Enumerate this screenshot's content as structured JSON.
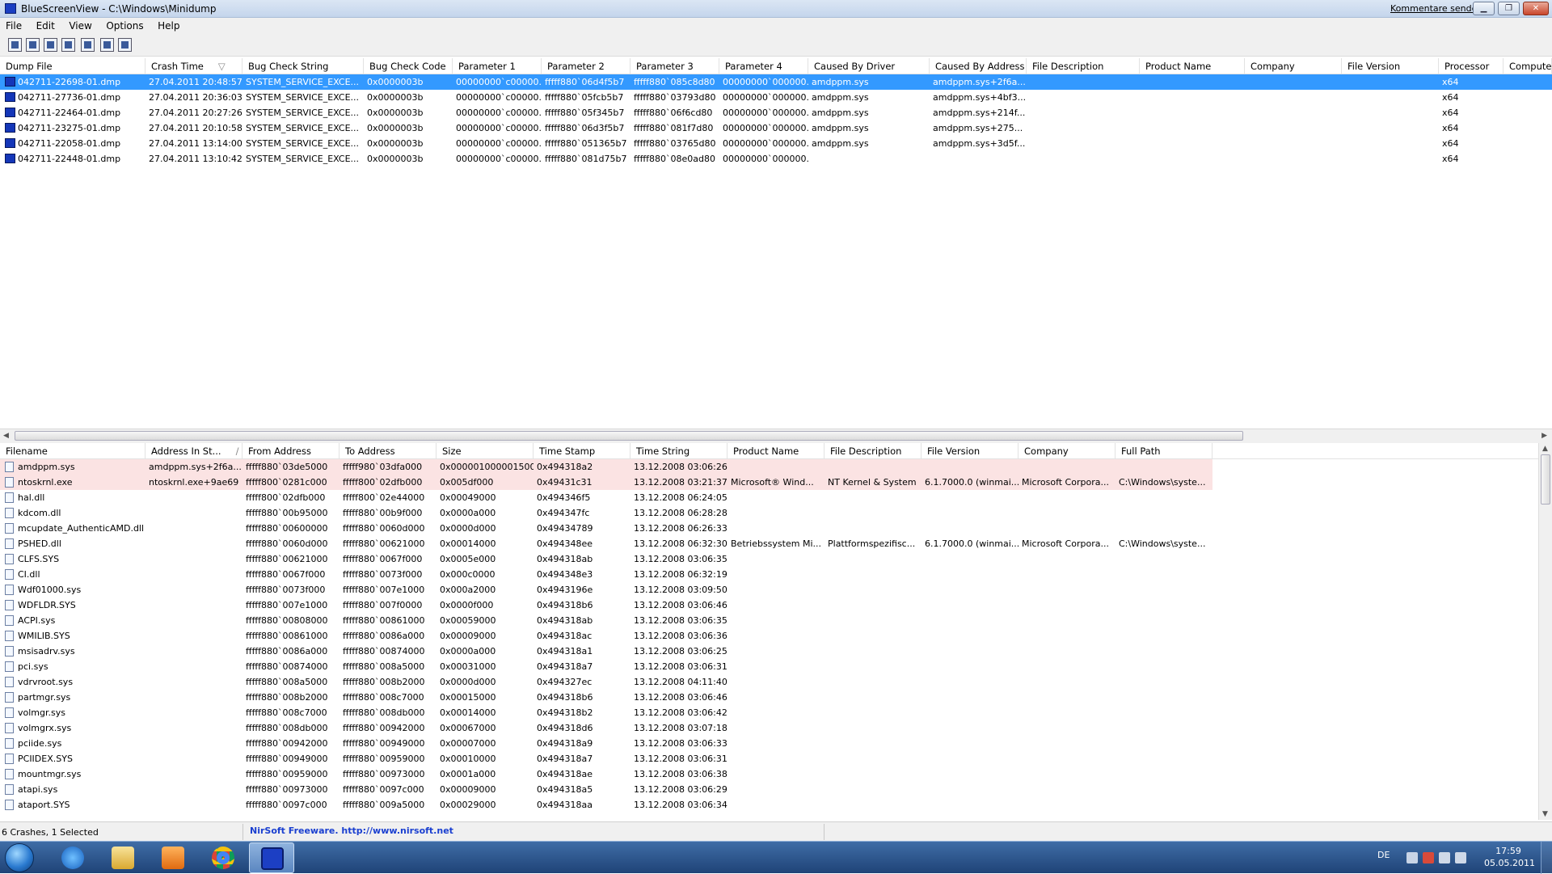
{
  "window": {
    "title": "BlueScreenView  -  C:\\Windows\\Minidump",
    "feedback_link": "Kommentare senden",
    "minimize": "▁",
    "maximize": "❐",
    "close": "✕"
  },
  "menu": [
    "File",
    "Edit",
    "View",
    "Options",
    "Help"
  ],
  "toolbar": {
    "icons": [
      "properties-icon",
      "save-icon",
      "refresh-icon",
      "copy-icon",
      "advanced-options-icon",
      "find-icon",
      "exit-icon"
    ]
  },
  "upper_columns": [
    "Dump File",
    "Crash Time",
    "Bug Check String",
    "Bug Check Code",
    "Parameter 1",
    "Parameter 2",
    "Parameter 3",
    "Parameter 4",
    "Caused By Driver",
    "Caused By Address",
    "File Description",
    "Product Name",
    "Company",
    "File Version",
    "Processor",
    "Computer"
  ],
  "upper_sort_indicator": "▽",
  "crashes": [
    [
      "042711-22698-01.dmp",
      "27.04.2011 20:48:57",
      "SYSTEM_SERVICE_EXCE...",
      "0x0000003b",
      "00000000`c00000...",
      "fffff880`06d4f5b7",
      "fffff880`085c8d80",
      "00000000`000000...",
      "amdppm.sys",
      "amdppm.sys+2f6a...",
      "",
      "",
      "",
      "",
      "x64",
      ""
    ],
    [
      "042711-27736-01.dmp",
      "27.04.2011 20:36:03",
      "SYSTEM_SERVICE_EXCE...",
      "0x0000003b",
      "00000000`c00000...",
      "fffff880`05fcb5b7",
      "fffff880`03793d80",
      "00000000`000000...",
      "amdppm.sys",
      "amdppm.sys+4bf3...",
      "",
      "",
      "",
      "",
      "x64",
      ""
    ],
    [
      "042711-22464-01.dmp",
      "27.04.2011 20:27:26",
      "SYSTEM_SERVICE_EXCE...",
      "0x0000003b",
      "00000000`c00000...",
      "fffff880`05f345b7",
      "fffff880`06f6cd80",
      "00000000`000000...",
      "amdppm.sys",
      "amdppm.sys+214f...",
      "",
      "",
      "",
      "",
      "x64",
      ""
    ],
    [
      "042711-23275-01.dmp",
      "27.04.2011 20:10:58",
      "SYSTEM_SERVICE_EXCE...",
      "0x0000003b",
      "00000000`c00000...",
      "fffff880`06d3f5b7",
      "fffff880`081f7d80",
      "00000000`000000...",
      "amdppm.sys",
      "amdppm.sys+275...",
      "",
      "",
      "",
      "",
      "x64",
      ""
    ],
    [
      "042711-22058-01.dmp",
      "27.04.2011 13:14:00",
      "SYSTEM_SERVICE_EXCE...",
      "0x0000003b",
      "00000000`c00000...",
      "fffff880`051365b7",
      "fffff880`03765d80",
      "00000000`000000...",
      "amdppm.sys",
      "amdppm.sys+3d5f...",
      "",
      "",
      "",
      "",
      "x64",
      ""
    ],
    [
      "042711-22448-01.dmp",
      "27.04.2011 13:10:42",
      "SYSTEM_SERVICE_EXCE...",
      "0x0000003b",
      "00000000`c00000...",
      "fffff880`081d75b7",
      "fffff880`08e0ad80",
      "00000000`000000...",
      "",
      "",
      "",
      "",
      "",
      "",
      "x64",
      ""
    ]
  ],
  "lower_columns": [
    "Filename",
    "Address In St...",
    "From Address",
    "To Address",
    "Size",
    "Time Stamp",
    "Time String",
    "Product Name",
    "File Description",
    "File Version",
    "Company",
    "Full Path"
  ],
  "lower_sort_indicator": "/",
  "drivers": [
    [
      "amdppm.sys",
      "amdppm.sys+2f6a...",
      "fffff880`03de5000",
      "fffff980`03dfa000",
      "0x0000010000015000",
      "0x494318a2",
      "13.12.2008 03:06:26",
      "",
      "",
      "",
      "",
      ""
    ],
    [
      "ntoskrnl.exe",
      "ntoskrnl.exe+9ae69",
      "fffff800`0281c000",
      "fffff800`02dfb000",
      "0x005df000",
      "0x49431c31",
      "13.12.2008 03:21:37",
      "Microsoft® Wind...",
      "NT Kernel & System",
      "6.1.7000.0 (winmai...",
      "Microsoft Corpora...",
      "C:\\Windows\\syste..."
    ],
    [
      "hal.dll",
      "",
      "fffff800`02dfb000",
      "fffff800`02e44000",
      "0x00049000",
      "0x494346f5",
      "13.12.2008 06:24:05",
      "",
      "",
      "",
      "",
      ""
    ],
    [
      "kdcom.dll",
      "",
      "fffff880`00b95000",
      "fffff880`00b9f000",
      "0x0000a000",
      "0x494347fc",
      "13.12.2008 06:28:28",
      "",
      "",
      "",
      "",
      ""
    ],
    [
      "mcupdate_AuthenticAMD.dll",
      "",
      "fffff880`00600000",
      "fffff880`0060d000",
      "0x0000d000",
      "0x49434789",
      "13.12.2008 06:26:33",
      "",
      "",
      "",
      "",
      ""
    ],
    [
      "PSHED.dll",
      "",
      "fffff880`0060d000",
      "fffff880`00621000",
      "0x00014000",
      "0x494348ee",
      "13.12.2008 06:32:30",
      "Betriebssystem Mi...",
      "Plattformspezifisc...",
      "6.1.7000.0 (winmai...",
      "Microsoft Corpora...",
      "C:\\Windows\\syste..."
    ],
    [
      "CLFS.SYS",
      "",
      "fffff880`00621000",
      "fffff880`0067f000",
      "0x0005e000",
      "0x494318ab",
      "13.12.2008 03:06:35",
      "",
      "",
      "",
      "",
      ""
    ],
    [
      "CI.dll",
      "",
      "fffff880`0067f000",
      "fffff880`0073f000",
      "0x000c0000",
      "0x494348e3",
      "13.12.2008 06:32:19",
      "",
      "",
      "",
      "",
      ""
    ],
    [
      "Wdf01000.sys",
      "",
      "fffff880`0073f000",
      "fffff880`007e1000",
      "0x000a2000",
      "0x4943196e",
      "13.12.2008 03:09:50",
      "",
      "",
      "",
      "",
      ""
    ],
    [
      "WDFLDR.SYS",
      "",
      "fffff880`007e1000",
      "fffff880`007f0000",
      "0x0000f000",
      "0x494318b6",
      "13.12.2008 03:06:46",
      "",
      "",
      "",
      "",
      ""
    ],
    [
      "ACPI.sys",
      "",
      "fffff880`00808000",
      "fffff880`00861000",
      "0x00059000",
      "0x494318ab",
      "13.12.2008 03:06:35",
      "",
      "",
      "",
      "",
      ""
    ],
    [
      "WMILIB.SYS",
      "",
      "fffff880`00861000",
      "fffff880`0086a000",
      "0x00009000",
      "0x494318ac",
      "13.12.2008 03:06:36",
      "",
      "",
      "",
      "",
      ""
    ],
    [
      "msisadrv.sys",
      "",
      "fffff880`0086a000",
      "fffff880`00874000",
      "0x0000a000",
      "0x494318a1",
      "13.12.2008 03:06:25",
      "",
      "",
      "",
      "",
      ""
    ],
    [
      "pci.sys",
      "",
      "fffff880`00874000",
      "fffff880`008a5000",
      "0x00031000",
      "0x494318a7",
      "13.12.2008 03:06:31",
      "",
      "",
      "",
      "",
      ""
    ],
    [
      "vdrvroot.sys",
      "",
      "fffff880`008a5000",
      "fffff880`008b2000",
      "0x0000d000",
      "0x494327ec",
      "13.12.2008 04:11:40",
      "",
      "",
      "",
      "",
      ""
    ],
    [
      "partmgr.sys",
      "",
      "fffff880`008b2000",
      "fffff880`008c7000",
      "0x00015000",
      "0x494318b6",
      "13.12.2008 03:06:46",
      "",
      "",
      "",
      "",
      ""
    ],
    [
      "volmgr.sys",
      "",
      "fffff880`008c7000",
      "fffff880`008db000",
      "0x00014000",
      "0x494318b2",
      "13.12.2008 03:06:42",
      "",
      "",
      "",
      "",
      ""
    ],
    [
      "volmgrx.sys",
      "",
      "fffff880`008db000",
      "fffff880`00942000",
      "0x00067000",
      "0x494318d6",
      "13.12.2008 03:07:18",
      "",
      "",
      "",
      "",
      ""
    ],
    [
      "pciide.sys",
      "",
      "fffff880`00942000",
      "fffff880`00949000",
      "0x00007000",
      "0x494318a9",
      "13.12.2008 03:06:33",
      "",
      "",
      "",
      "",
      ""
    ],
    [
      "PCIIDEX.SYS",
      "",
      "fffff880`00949000",
      "fffff880`00959000",
      "0x00010000",
      "0x494318a7",
      "13.12.2008 03:06:31",
      "",
      "",
      "",
      "",
      ""
    ],
    [
      "mountmgr.sys",
      "",
      "fffff880`00959000",
      "fffff880`00973000",
      "0x0001a000",
      "0x494318ae",
      "13.12.2008 03:06:38",
      "",
      "",
      "",
      "",
      ""
    ],
    [
      "atapi.sys",
      "",
      "fffff880`00973000",
      "fffff880`0097c000",
      "0x00009000",
      "0x494318a5",
      "13.12.2008 03:06:29",
      "",
      "",
      "",
      "",
      ""
    ],
    [
      "ataport.SYS",
      "",
      "fffff880`0097c000",
      "fffff880`009a5000",
      "0x00029000",
      "0x494318aa",
      "13.12.2008 03:06:34",
      "",
      "",
      "",
      "",
      ""
    ]
  ],
  "status": {
    "count": "6 Crashes, 1 Selected",
    "credit": "NirSoft Freeware.  http://www.nirsoft.net"
  },
  "taskbar": {
    "apps": [
      "start-orb",
      "internet-explorer-icon",
      "windows-explorer-icon",
      "media-player-icon",
      "chrome-icon",
      "bluescreenview-icon"
    ],
    "lang": "DE",
    "time": "17:59",
    "date": "05.05.2011"
  }
}
